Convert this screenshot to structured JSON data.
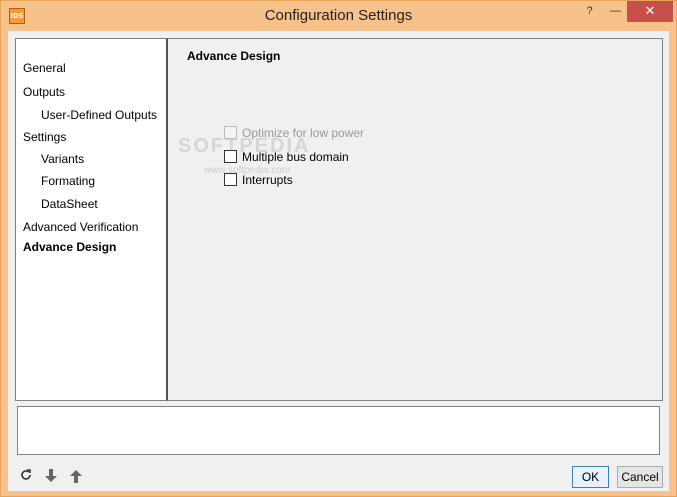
{
  "window": {
    "title": "Configuration Settings",
    "icon_text": "IDS",
    "help_glyph": "?",
    "minimize_glyph": "—",
    "close_glyph": "✕"
  },
  "nav": {
    "items": [
      {
        "label": "General"
      },
      {
        "label": "Outputs"
      },
      {
        "label": "User-Defined Outputs"
      },
      {
        "label": "Settings"
      },
      {
        "label": "Variants"
      },
      {
        "label": "Formating"
      },
      {
        "label": "DataSheet"
      },
      {
        "label": "Advanced Verification"
      },
      {
        "label": "Advance Design"
      }
    ]
  },
  "panel": {
    "title": "Advance Design",
    "options": [
      {
        "label": "Optimize for low power",
        "checked": false,
        "enabled": false
      },
      {
        "label": "Multiple bus domain",
        "checked": false,
        "enabled": true
      },
      {
        "label": "Interrupts",
        "checked": false,
        "enabled": true
      }
    ],
    "watermark": "SOFTPEDIA",
    "watermark_url": "www.softpedia.com"
  },
  "description": "",
  "toolbar": {
    "reset_icon": "refresh-icon",
    "import_icon": "download-icon",
    "export_icon": "upload-icon"
  },
  "buttons": {
    "ok_label": "OK",
    "cancel_label": "Cancel"
  }
}
